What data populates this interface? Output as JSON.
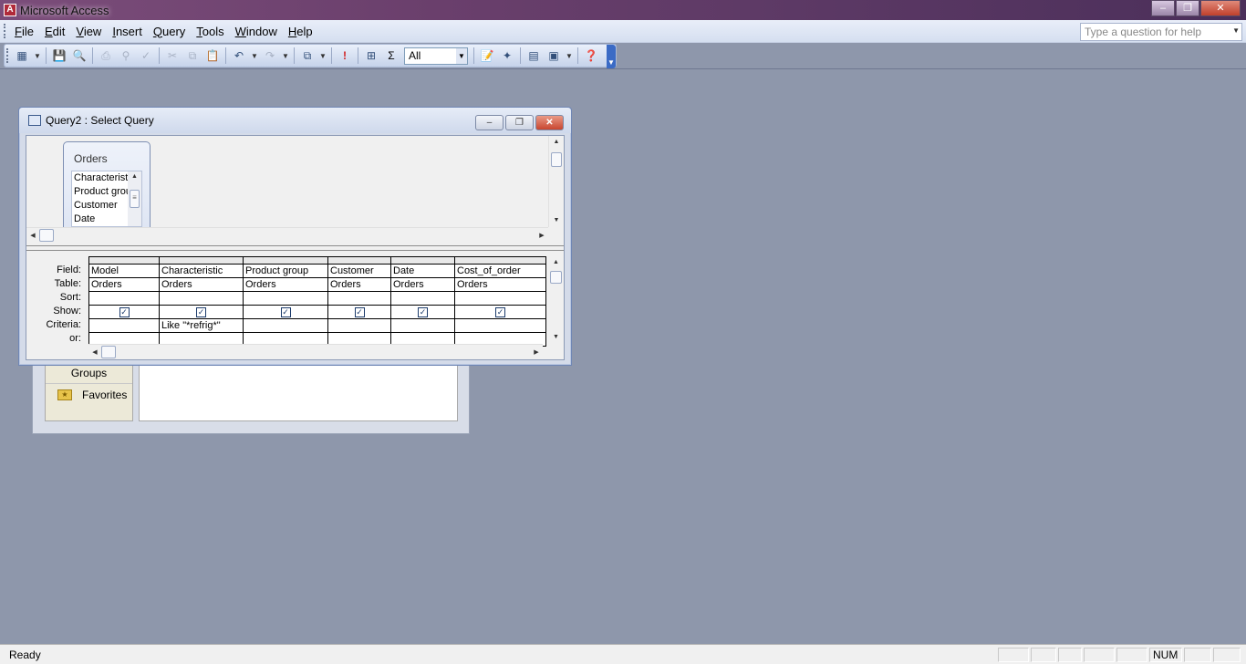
{
  "app": {
    "title": "Microsoft Access",
    "icon_label": "A",
    "window_buttons": [
      "minimize",
      "restore",
      "close"
    ]
  },
  "menubar": {
    "items": [
      {
        "label": "File",
        "accel": "F"
      },
      {
        "label": "Edit",
        "accel": "E"
      },
      {
        "label": "View",
        "accel": "V"
      },
      {
        "label": "Insert",
        "accel": "I"
      },
      {
        "label": "Query",
        "accel": "Q"
      },
      {
        "label": "Tools",
        "accel": "T"
      },
      {
        "label": "Window",
        "accel": "W"
      },
      {
        "label": "Help",
        "accel": "H"
      }
    ],
    "help_placeholder": "Type a question for help"
  },
  "toolbar": {
    "top_values": "All",
    "icons": [
      "view-icon",
      "save-icon",
      "search-icon",
      "print-icon",
      "print-preview-icon",
      "spelling-icon",
      "cut-icon",
      "copy-icon",
      "paste-icon",
      "undo-icon",
      "redo-icon",
      "query-type-icon",
      "run-icon",
      "show-table-icon",
      "totals-icon",
      "properties-icon",
      "build-icon",
      "database-window-icon",
      "new-object-icon",
      "help-icon"
    ]
  },
  "db_window": {
    "groups_label": "Groups",
    "favorites_label": "Favorites"
  },
  "query_window": {
    "title": "Query2 : Select Query",
    "table": {
      "name": "Orders",
      "fields": [
        "Characteristic",
        "Product group",
        "Customer",
        "Date"
      ]
    },
    "row_labels": [
      "Field:",
      "Table:",
      "Sort:",
      "Show:",
      "Criteria:",
      "or:"
    ],
    "columns": [
      {
        "field": "Model",
        "table": "Orders",
        "sort": "",
        "show": true,
        "criteria": "",
        "or": ""
      },
      {
        "field": "Characteristic",
        "table": "Orders",
        "sort": "",
        "show": true,
        "criteria": "Like \"*refrig*\"",
        "or": ""
      },
      {
        "field": "Product group",
        "table": "Orders",
        "sort": "",
        "show": true,
        "criteria": "",
        "or": ""
      },
      {
        "field": "Customer",
        "table": "Orders",
        "sort": "",
        "show": true,
        "criteria": "",
        "or": ""
      },
      {
        "field": "Date",
        "table": "Orders",
        "sort": "",
        "show": true,
        "criteria": "",
        "or": ""
      },
      {
        "field": "Cost_of_order",
        "table": "Orders",
        "sort": "",
        "show": true,
        "criteria": "",
        "or": ""
      }
    ]
  },
  "statusbar": {
    "status": "Ready",
    "num": "NUM"
  }
}
